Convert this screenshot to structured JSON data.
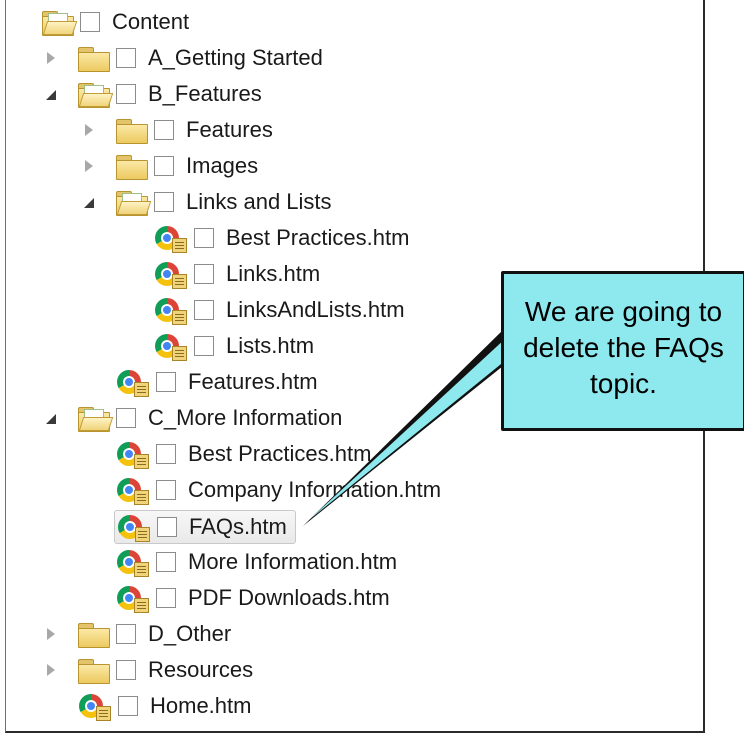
{
  "tree": {
    "root": {
      "label": "Content"
    },
    "a_getting_started": {
      "label": "A_Getting Started"
    },
    "b_features": {
      "label": "B_Features"
    },
    "features_folder": {
      "label": "Features"
    },
    "images_folder": {
      "label": "Images"
    },
    "links_and_lists_folder": {
      "label": "Links and Lists"
    },
    "best_practices_1": {
      "label": "Best Practices.htm"
    },
    "links": {
      "label": "Links.htm"
    },
    "links_and_lists_file": {
      "label": "LinksAndLists.htm"
    },
    "lists": {
      "label": "Lists.htm"
    },
    "features_file": {
      "label": "Features.htm"
    },
    "c_more_information": {
      "label": "C_More Information"
    },
    "best_practices_2": {
      "label": "Best Practices.htm"
    },
    "company_information": {
      "label": "Company Information.htm"
    },
    "faqs": {
      "label": "FAQs.htm"
    },
    "more_information": {
      "label": "More Information.htm"
    },
    "pdf_downloads": {
      "label": "PDF Downloads.htm"
    },
    "d_other": {
      "label": "D_Other"
    },
    "resources": {
      "label": "Resources"
    },
    "home": {
      "label": "Home.htm"
    }
  },
  "callout": {
    "line1": "We are going to",
    "line2": "delete the FAQs",
    "line3": "topic."
  },
  "colors": {
    "callout_fill": "#8ee9ee",
    "callout_border": "#111111",
    "selected_row": "#e9e9e9"
  },
  "icons": [
    "folder-icon",
    "open-folder-icon",
    "chrome-topic-icon",
    "collapsed-arrow-icon",
    "expanded-arrow-icon",
    "checkbox"
  ]
}
